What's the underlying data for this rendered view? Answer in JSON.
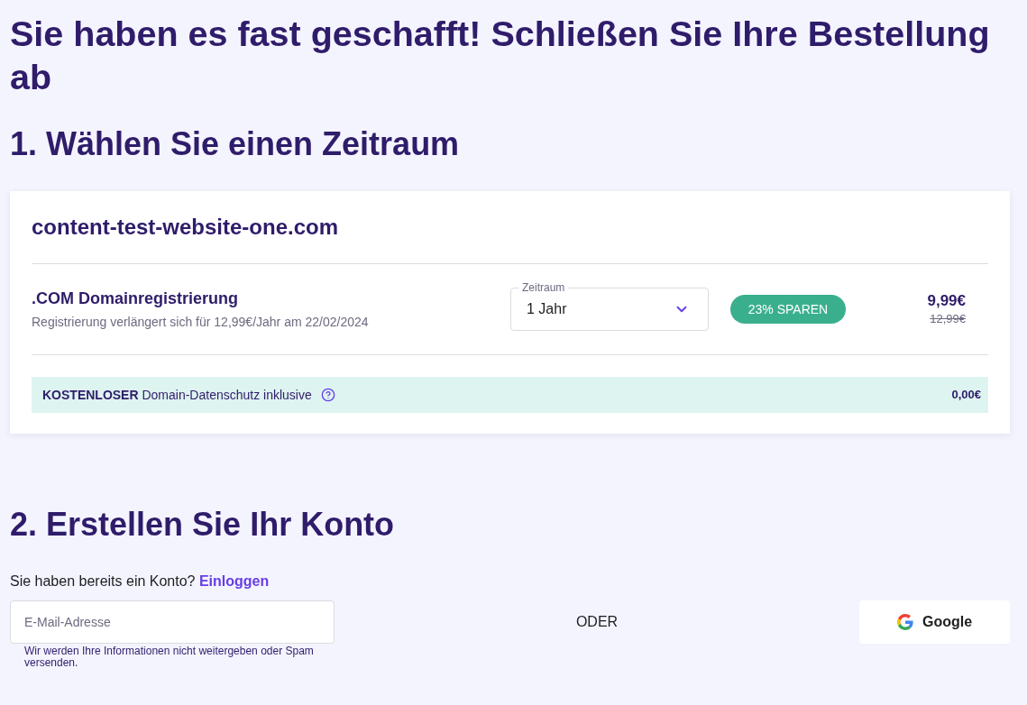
{
  "page": {
    "title": "Sie haben es fast geschafft! Schließen Sie Ihre Bestellung ab"
  },
  "step_1": {
    "heading": "1. Wählen Sie einen Zeitraum",
    "domain": "content-test-website-one.com",
    "product": {
      "name": ".COM Domainregistrierung",
      "note": "Registrierung verlängert sich für 12,99€/Jahr am 22/02/2024",
      "period_select": {
        "label": "Zeitraum",
        "value": "1 Jahr"
      },
      "badge": "23% SPAREN",
      "price": "9,99€",
      "old_price": "12,99€"
    },
    "privacy": {
      "text": "**KOSTENLOSER** Domain-Datenschutz inklusive",
      "price": "0,00€"
    }
  },
  "step_2": {
    "heading": "2. Erstellen Sie Ihr Konto",
    "prompt": "Sie haben bereits ein Konto?",
    "login_link": "Einloggen",
    "email": {
      "placeholder": "E-Mail-Adresse"
    },
    "hint": "Wir werden Ihre Informationen nicht weitergeben oder Spam versenden.",
    "separator": "ODER",
    "google_button": "Google"
  }
}
